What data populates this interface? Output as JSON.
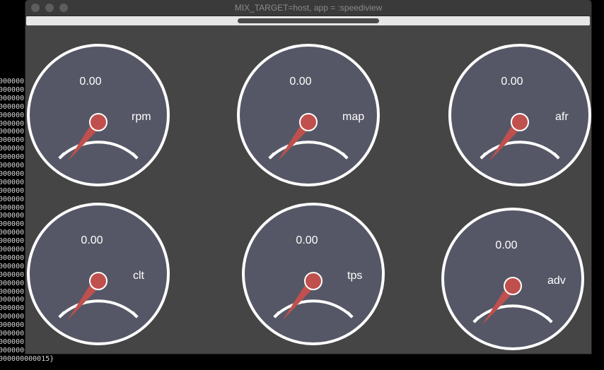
{
  "window": {
    "title": "MIX_TARGET=host, app = :speediview"
  },
  "terminal": {
    "lines": [
      "000000",
      "000000",
      "000000",
      "000000",
      "000000",
      "000000",
      "000000",
      "000000",
      "000000",
      "000000",
      "000000",
      "000000",
      "000000",
      "000000",
      "000000",
      "000000",
      "000000",
      "000000",
      "000000",
      "000000",
      "000000",
      "000000",
      "000000",
      "000000",
      "000000",
      "000000",
      "000000",
      "000000",
      "000000",
      "000000",
      "000000",
      "000000",
      "000000000015}",
      "000000000015}"
    ]
  },
  "colors": {
    "gauge_face": "#565766",
    "gauge_rim": "#ffffff",
    "needle": "#c0504d",
    "window_bg": "#454545"
  },
  "gauges": [
    {
      "label": "rpm",
      "value": "0.00"
    },
    {
      "label": "map",
      "value": "0.00"
    },
    {
      "label": "afr",
      "value": "0.00"
    },
    {
      "label": "clt",
      "value": "0.00"
    },
    {
      "label": "tps",
      "value": "0.00"
    },
    {
      "label": "adv",
      "value": "0.00"
    }
  ]
}
